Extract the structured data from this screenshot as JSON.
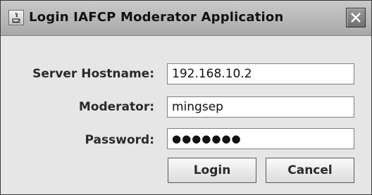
{
  "window": {
    "title": "Login IAFCP Moderator Application",
    "app_icon": "java-app-icon",
    "close_icon": "close-icon"
  },
  "form": {
    "server": {
      "label": "Server Hostname:",
      "value": "192.168.10.2"
    },
    "moderator": {
      "label": "Moderator:",
      "value": "mingsep"
    },
    "password": {
      "label": "Password:",
      "value": "●●●●●●●"
    }
  },
  "buttons": {
    "login_label": "Login",
    "cancel_label": "Cancel"
  },
  "colors": {
    "titlebar": "#b4b4b4",
    "background": "#e6e6e6"
  }
}
